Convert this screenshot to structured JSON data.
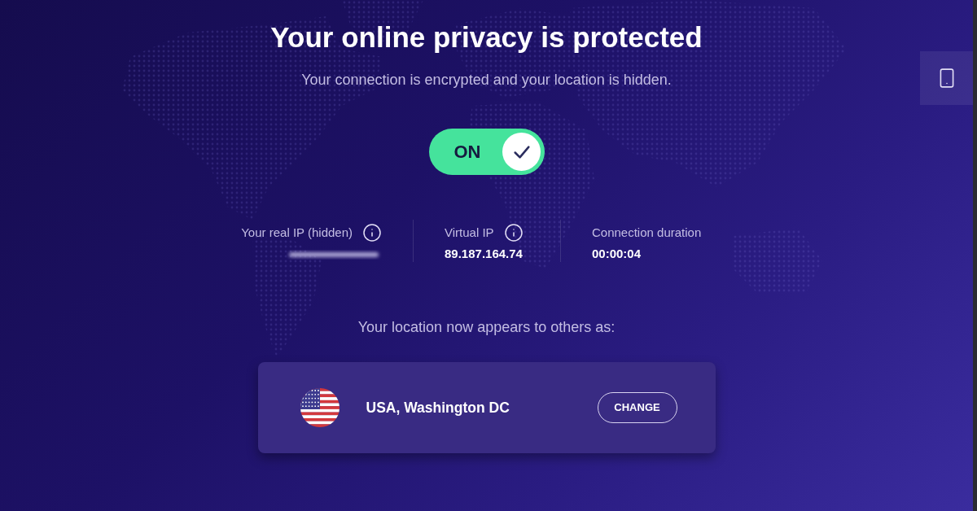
{
  "header": {
    "title": "Your online privacy is protected",
    "subtitle": "Your connection is encrypted and your location is hidden."
  },
  "toggle": {
    "label": "ON",
    "on": true
  },
  "stats": [
    {
      "kind": "blurred",
      "label": "Your real IP (hidden)"
    },
    {
      "kind": "info",
      "label": "Virtual IP",
      "value": "89.187.164.74"
    },
    {
      "kind": "plain",
      "label": "Connection duration",
      "value": "00:00:04"
    }
  ],
  "location": {
    "prompt": "Your location now appears to others as:",
    "place": "USA, Washington DC",
    "button": "CHANGE"
  }
}
